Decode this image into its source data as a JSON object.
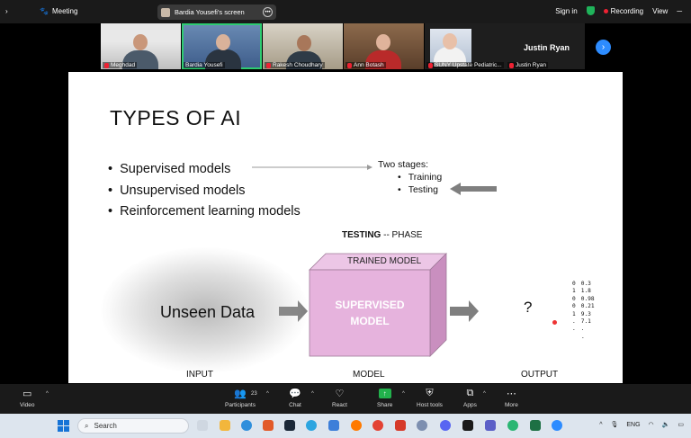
{
  "topbar": {
    "meeting_label": "Meeting",
    "shared_screen_label": "Bardia Yousefi's screen",
    "signin_label": "Sign in",
    "recording_label": "Recording",
    "view_label": "View"
  },
  "gallery": {
    "participants": [
      {
        "name": "Meghdad",
        "muted": true
      },
      {
        "name": "Bardia Yousefi",
        "muted": false,
        "active": true
      },
      {
        "name": "Rakesh Choudhary",
        "muted": true
      },
      {
        "name": "Ann Botash",
        "muted": true
      },
      {
        "name": "SUNY Upstate Pediatric...",
        "muted": true
      }
    ],
    "featured": {
      "display_name": "Justin Ryan",
      "name": "Justin Ryan",
      "muted": true
    }
  },
  "slide": {
    "title": "TYPES OF AI",
    "bullets": [
      "Supervised models",
      "Unsupervised models",
      "Reinforcement learning models"
    ],
    "stages": {
      "heading": "Two stages:",
      "items": [
        "Training",
        "Testing"
      ]
    },
    "phase_bold": "TESTING",
    "phase_rest": " -- PHASE",
    "unseen_data": "Unseen Data",
    "box_top_label": "TRAINED MODEL",
    "box_front_line1": "SUPERVISED",
    "box_front_line2": "MODEL",
    "question_mark": "?",
    "label_input": "INPUT",
    "label_model": "MODEL",
    "label_output": "OUTPUT",
    "output_rows": [
      [
        "0",
        "0.3"
      ],
      [
        "1",
        "1.8"
      ],
      [
        "0",
        "0.98"
      ],
      [
        "0",
        "0.21"
      ],
      [
        "1",
        "9.3"
      ],
      [
        ".",
        "7.1"
      ],
      [
        ".",
        "."
      ],
      [
        "",
        "."
      ]
    ]
  },
  "controls": {
    "video": "Video",
    "participants": "Participants",
    "participants_count": "23",
    "chat": "Chat",
    "react": "React",
    "share": "Share",
    "host_tools": "Host tools",
    "apps": "Apps",
    "more": "More"
  },
  "taskbar": {
    "search_placeholder": "Search",
    "language": "ENG"
  },
  "colors": {
    "accent_blue": "#2d8cff",
    "share_green": "#22b14c",
    "box_pink": "#e6b3dd",
    "recording_red": "#e22233"
  }
}
